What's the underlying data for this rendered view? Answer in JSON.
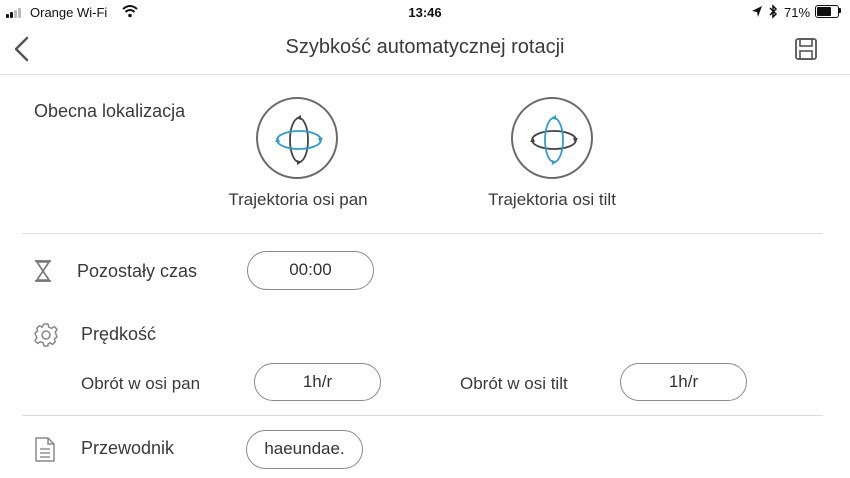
{
  "status_bar": {
    "carrier": "Orange Wi-Fi",
    "time": "13:46",
    "battery_percent": "71%",
    "battery_level": 0.71
  },
  "header": {
    "title": "Szybkość automatycznej rotacji",
    "back_icon": "chevron-left-icon",
    "save_icon": "floppy-disk-icon"
  },
  "location": {
    "label": "Obecna lokalizacja",
    "pan_caption": "Trajektoria osi pan",
    "tilt_caption": "Trajektoria osi tilt"
  },
  "remaining": {
    "label": "Pozostały czas",
    "value": "00:00"
  },
  "speed": {
    "label": "Prędkość",
    "pan_label": "Obrót w osi pan",
    "pan_value": "1h/r",
    "tilt_label": "Obrót w osi tilt",
    "tilt_value": "1h/r"
  },
  "guide": {
    "label": "Przewodnik",
    "value": "haeundae."
  },
  "colors": {
    "accent": "#2a9fd6",
    "text": "#3a3a3a",
    "divider": "#dcdcdc"
  }
}
